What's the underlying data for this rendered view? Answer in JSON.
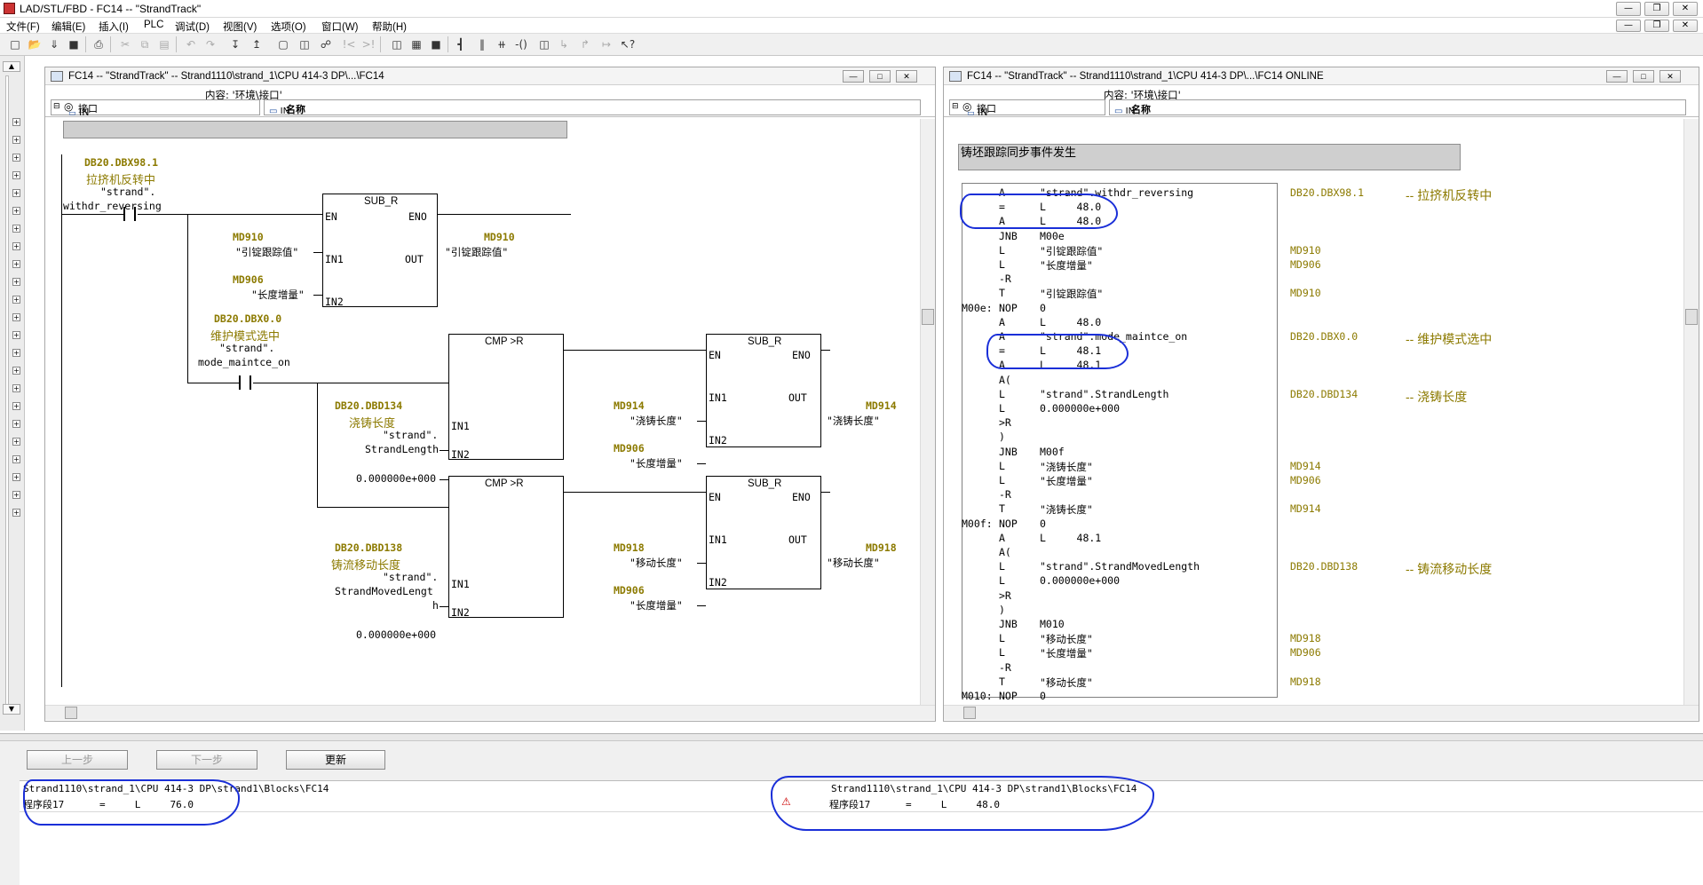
{
  "window": {
    "title": "LAD/STL/FBD  - FC14 -- \"StrandTrack\""
  },
  "menu": [
    "文件(F)",
    "编辑(E)",
    "插入(I)",
    "PLC",
    "调试(D)",
    "视图(V)",
    "选项(O)",
    "窗口(W)",
    "帮助(H)"
  ],
  "left_pane": {
    "title": "FC14 -- \"StrandTrack\" -- Strand1110\\strand_1\\CPU 414-3 DP\\...\\FC14",
    "content_label": "内容: '环境\\接口'",
    "tree_root": "接口",
    "tree_child": "IN",
    "col_name": "名称",
    "col_row": "IN",
    "network1": {
      "contact_addr": "DB20.DBX98.1",
      "contact_comment": "拉挤机反转中",
      "contact_sym1": "\"strand\".",
      "contact_sym2": "withdr_reversing",
      "block": {
        "title": "SUB_R",
        "en": "EN",
        "eno": "ENO",
        "in1": "IN1",
        "in2": "IN2",
        "out": "OUT"
      },
      "in1_addr": "MD910",
      "in1_sym": "\"引锭跟踪值\"",
      "in2_addr": "MD906",
      "in2_sym": "\"长度增量\"",
      "out_addr": "MD910",
      "out_sym": "\"引锭跟踪值\""
    },
    "network2": {
      "contact_addr": "DB20.DBX0.0",
      "contact_comment": "维护模式选中",
      "contact_sym1": "\"strand\".",
      "contact_sym2": "mode_maintce_on",
      "cmp1": {
        "title": "CMP >R",
        "in1": "IN1",
        "in2": "IN2"
      },
      "cmp1_in1_addr": "DB20.DBD134",
      "cmp1_in1_comment": "浇铸长度",
      "cmp1_in1_sym1": "\"strand\".",
      "cmp1_in1_sym2": "StrandLength",
      "cmp1_in2": "0.000000e+000",
      "sub1": {
        "title": "SUB_R",
        "en": "EN",
        "eno": "ENO",
        "in1": "IN1",
        "in2": "IN2",
        "out": "OUT"
      },
      "sub1_in1_addr": "MD914",
      "sub1_in1_sym": "\"浇铸长度\"",
      "sub1_in2_addr": "MD906",
      "sub1_in2_sym": "\"长度增量\"",
      "sub1_out_addr": "MD914",
      "sub1_out_sym": "\"浇铸长度\"",
      "cmp2": {
        "title": "CMP >R",
        "in1": "IN1",
        "in2": "IN2"
      },
      "cmp2_in1_addr": "DB20.DBD138",
      "cmp2_in1_comment": "铸流移动长度",
      "cmp2_in1_sym1": "\"strand\".",
      "cmp2_in1_sym2": "StrandMovedLengt",
      "cmp2_in1_sym3": "h",
      "cmp2_in2": "0.000000e+000",
      "sub2": {
        "title": "SUB_R",
        "en": "EN",
        "eno": "ENO",
        "in1": "IN1",
        "in2": "IN2",
        "out": "OUT"
      },
      "sub2_in1_addr": "MD918",
      "sub2_in1_sym": "\"移动长度\"",
      "sub2_in2_addr": "MD906",
      "sub2_in2_sym": "\"长度增量\"",
      "sub2_out_addr": "MD918",
      "sub2_out_sym": "\"移动长度\""
    }
  },
  "right_pane": {
    "title": "FC14 -- \"StrandTrack\" -- Strand1110\\strand_1\\CPU 414-3 DP\\...\\FC14  ONLINE",
    "content_label": "内容: '环境\\接口'",
    "tree_root": "接口",
    "tree_child": "IN",
    "col_name": "名称",
    "col_row": "IN",
    "network_title": "铸坯跟踪同步事件发生",
    "stl_rows": [
      {
        "label": "",
        "op": "A",
        "arg": "\"strand\".withdr_reversing",
        "addr": "DB20.DBX98.1",
        "comment": "-- 拉挤机反转中"
      },
      {
        "label": "",
        "op": "=",
        "arg": "L     48.0",
        "addr": "",
        "comment": ""
      },
      {
        "label": "",
        "op": "A",
        "arg": "L     48.0",
        "addr": "",
        "comment": ""
      },
      {
        "label": "",
        "op": "JNB",
        "arg": "M00e",
        "addr": "",
        "comment": ""
      },
      {
        "label": "",
        "op": "L",
        "arg": "\"引锭跟踪值\"",
        "addr": "MD910",
        "comment": ""
      },
      {
        "label": "",
        "op": "L",
        "arg": "\"长度增量\"",
        "addr": "MD906",
        "comment": ""
      },
      {
        "label": "",
        "op": "-R",
        "arg": "",
        "addr": "",
        "comment": ""
      },
      {
        "label": "",
        "op": "T",
        "arg": "\"引锭跟踪值\"",
        "addr": "MD910",
        "comment": ""
      },
      {
        "label": "M00e:",
        "op": "NOP",
        "arg": "0",
        "addr": "",
        "comment": ""
      },
      {
        "label": "",
        "op": "A",
        "arg": "L     48.0",
        "addr": "",
        "comment": ""
      },
      {
        "label": "",
        "op": "A",
        "arg": "\"strand\".mode_maintce_on",
        "addr": "DB20.DBX0.0",
        "comment": "-- 维护模式选中"
      },
      {
        "label": "",
        "op": "=",
        "arg": "L     48.1",
        "addr": "",
        "comment": ""
      },
      {
        "label": "",
        "op": "A",
        "arg": "L     48.1",
        "addr": "",
        "comment": ""
      },
      {
        "label": "",
        "op": "A(",
        "arg": "",
        "addr": "",
        "comment": ""
      },
      {
        "label": "",
        "op": "L",
        "arg": "\"strand\".StrandLength",
        "addr": "DB20.DBD134",
        "comment": "-- 浇铸长度"
      },
      {
        "label": "",
        "op": "L",
        "arg": "0.000000e+000",
        "addr": "",
        "comment": ""
      },
      {
        "label": "",
        "op": ">R",
        "arg": "",
        "addr": "",
        "comment": ""
      },
      {
        "label": "",
        "op": ")",
        "arg": "",
        "addr": "",
        "comment": ""
      },
      {
        "label": "",
        "op": "JNB",
        "arg": "M00f",
        "addr": "",
        "comment": ""
      },
      {
        "label": "",
        "op": "L",
        "arg": "\"浇铸长度\"",
        "addr": "MD914",
        "comment": ""
      },
      {
        "label": "",
        "op": "L",
        "arg": "\"长度增量\"",
        "addr": "MD906",
        "comment": ""
      },
      {
        "label": "",
        "op": "-R",
        "arg": "",
        "addr": "",
        "comment": ""
      },
      {
        "label": "",
        "op": "T",
        "arg": "\"浇铸长度\"",
        "addr": "MD914",
        "comment": ""
      },
      {
        "label": "M00f:",
        "op": "NOP",
        "arg": "0",
        "addr": "",
        "comment": ""
      },
      {
        "label": "",
        "op": "A",
        "arg": "L     48.1",
        "addr": "",
        "comment": ""
      },
      {
        "label": "",
        "op": "A(",
        "arg": "",
        "addr": "",
        "comment": ""
      },
      {
        "label": "",
        "op": "L",
        "arg": "\"strand\".StrandMovedLength",
        "addr": "DB20.DBD138",
        "comment": "-- 铸流移动长度"
      },
      {
        "label": "",
        "op": "L",
        "arg": "0.000000e+000",
        "addr": "",
        "comment": ""
      },
      {
        "label": "",
        "op": ">R",
        "arg": "",
        "addr": "",
        "comment": ""
      },
      {
        "label": "",
        "op": ")",
        "arg": "",
        "addr": "",
        "comment": ""
      },
      {
        "label": "",
        "op": "JNB",
        "arg": "M010",
        "addr": "",
        "comment": ""
      },
      {
        "label": "",
        "op": "L",
        "arg": "\"移动长度\"",
        "addr": "MD918",
        "comment": ""
      },
      {
        "label": "",
        "op": "L",
        "arg": "\"长度增量\"",
        "addr": "MD906",
        "comment": ""
      },
      {
        "label": "",
        "op": "-R",
        "arg": "",
        "addr": "",
        "comment": ""
      },
      {
        "label": "",
        "op": "T",
        "arg": "\"移动长度\"",
        "addr": "MD918",
        "comment": ""
      },
      {
        "label": "M010:",
        "op": "NOP",
        "arg": "0",
        "addr": "",
        "comment": ""
      }
    ]
  },
  "bottom": {
    "btn_prev": "上一步",
    "btn_next": "下一步",
    "btn_refresh": "更新",
    "left_path": "Strand1110\\strand_1\\CPU 414-3 DP\\strand1\\Blocks\\FC14",
    "left_line": "程序段17      =     L     76.0",
    "right_path": "Strand1110\\strand_1\\CPU 414-3 DP\\strand1\\Blocks\\FC14",
    "right_line": "程序段17      =     L     48.0"
  }
}
